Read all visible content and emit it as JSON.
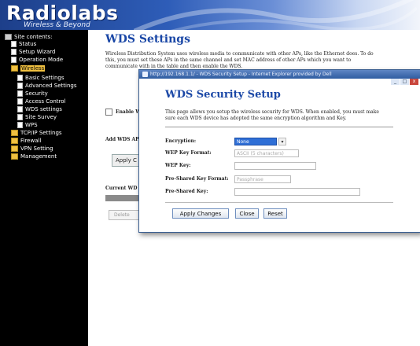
{
  "brand": {
    "logo_text": "Radiolabs",
    "tagline": "Wireless & Beyond"
  },
  "sidebar": {
    "items": [
      {
        "label": "Site contents:"
      },
      {
        "label": "Status"
      },
      {
        "label": "Setup Wizard"
      },
      {
        "label": "Operation Mode"
      },
      {
        "label": "Wireless"
      },
      {
        "label": "Basic Settings"
      },
      {
        "label": "Advanced Settings"
      },
      {
        "label": "Security"
      },
      {
        "label": "Access Control"
      },
      {
        "label": "WDS settings"
      },
      {
        "label": "Site Survey"
      },
      {
        "label": "WPS"
      },
      {
        "label": "TCP/IP Settings"
      },
      {
        "label": "Firewall"
      },
      {
        "label": "VPN Setting"
      },
      {
        "label": "Management"
      }
    ]
  },
  "page": {
    "title": "WDS Settings",
    "description": "Wireless Distribution System uses wireless media to communicate with other APs, like the Ethernet does. To do this, you must set these APs in the same channel and set MAC address of other APs which you want to communicate with in the table and then enable the WDS.",
    "enable_label": "Enable W",
    "add_label": "Add WDS AP",
    "apply_label": "Apply C",
    "current_label": "Current WD",
    "delete_label": "Delete"
  },
  "dialog": {
    "window_title": "http://192.168.1.1/ - WDS Security Setup - Internet Explorer provided by Dell",
    "title": "WDS Security Setup",
    "description": "This page allows you setup the wireless security for WDS. When enabled, you must make sure each WDS device has adopted the same encryption algorithm and Key.",
    "fields": {
      "encryption_label": "Encryption:",
      "encryption_value": "None",
      "wep_format_label": "WEP Key Format:",
      "wep_format_value": "ASCII (5 characters)",
      "wep_key_label": "WEP Key:",
      "psk_format_label": "Pre-Shared Key Format:",
      "psk_format_value": "Passphrase",
      "psk_label": "Pre-Shared Key:"
    },
    "buttons": {
      "apply": "Apply Changes",
      "close": "Close",
      "reset": "Reset"
    },
    "window_controls": {
      "minimize": "_",
      "maximize": "□",
      "close": "x"
    }
  },
  "colors": {
    "heading": "#1a47a6",
    "sidebar_bg": "#000000",
    "selected_field": "#2f6fd6"
  }
}
